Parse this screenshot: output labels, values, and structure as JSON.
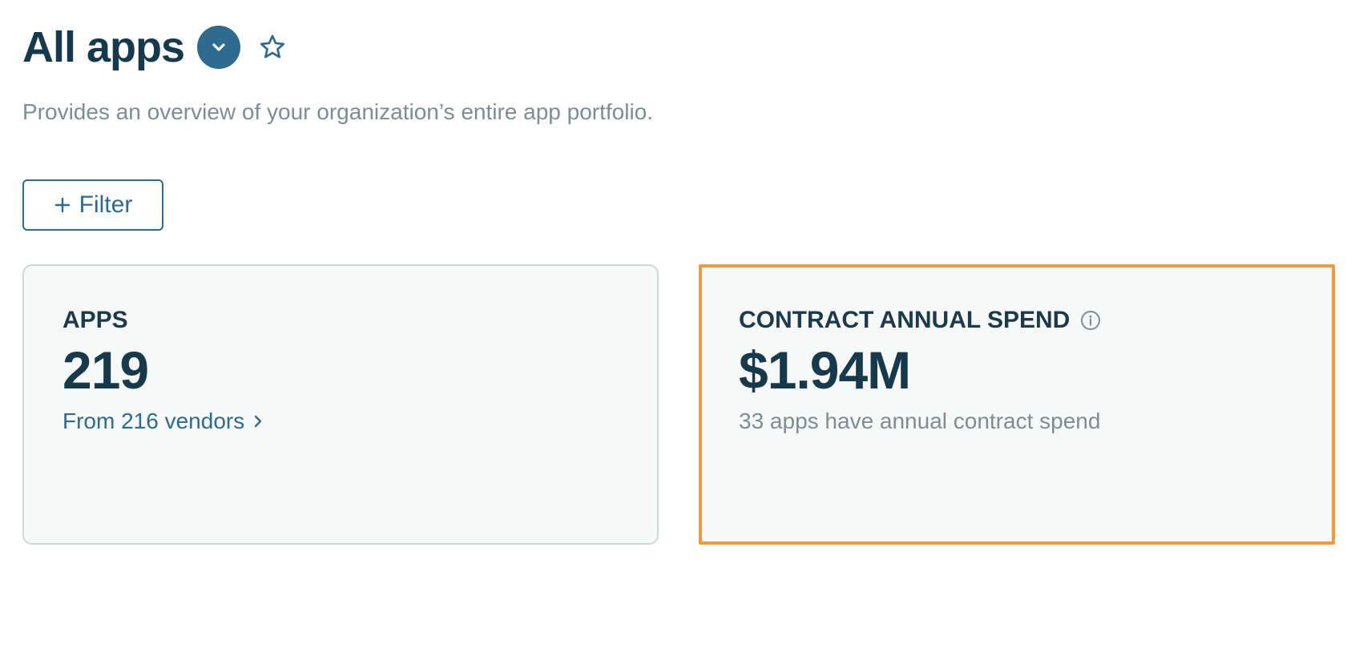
{
  "header": {
    "title": "All apps",
    "dropdown_icon": "chevron-down-icon",
    "favorite_icon": "star-icon",
    "subtitle": "Provides an overview of your organization’s entire app portfolio."
  },
  "toolbar": {
    "filter_icon": "plus-icon",
    "filter_label": "Filter"
  },
  "cards": {
    "apps": {
      "label": "APPS",
      "value": "219",
      "link_text": "From 216 vendors",
      "link_icon": "chevron-right-icon"
    },
    "spend": {
      "label": "CONTRACT ANNUAL SPEND",
      "info_icon": "info-icon",
      "value": "$1.94M",
      "note": "33 apps have annual contract spend",
      "highlight_color": "#ef9a3d"
    }
  },
  "colors": {
    "primary": "#2e6b8e",
    "heading": "#16394b",
    "muted": "#7d8d94",
    "card_background": "#f7f9f9",
    "highlight": "#ef9a3d"
  }
}
